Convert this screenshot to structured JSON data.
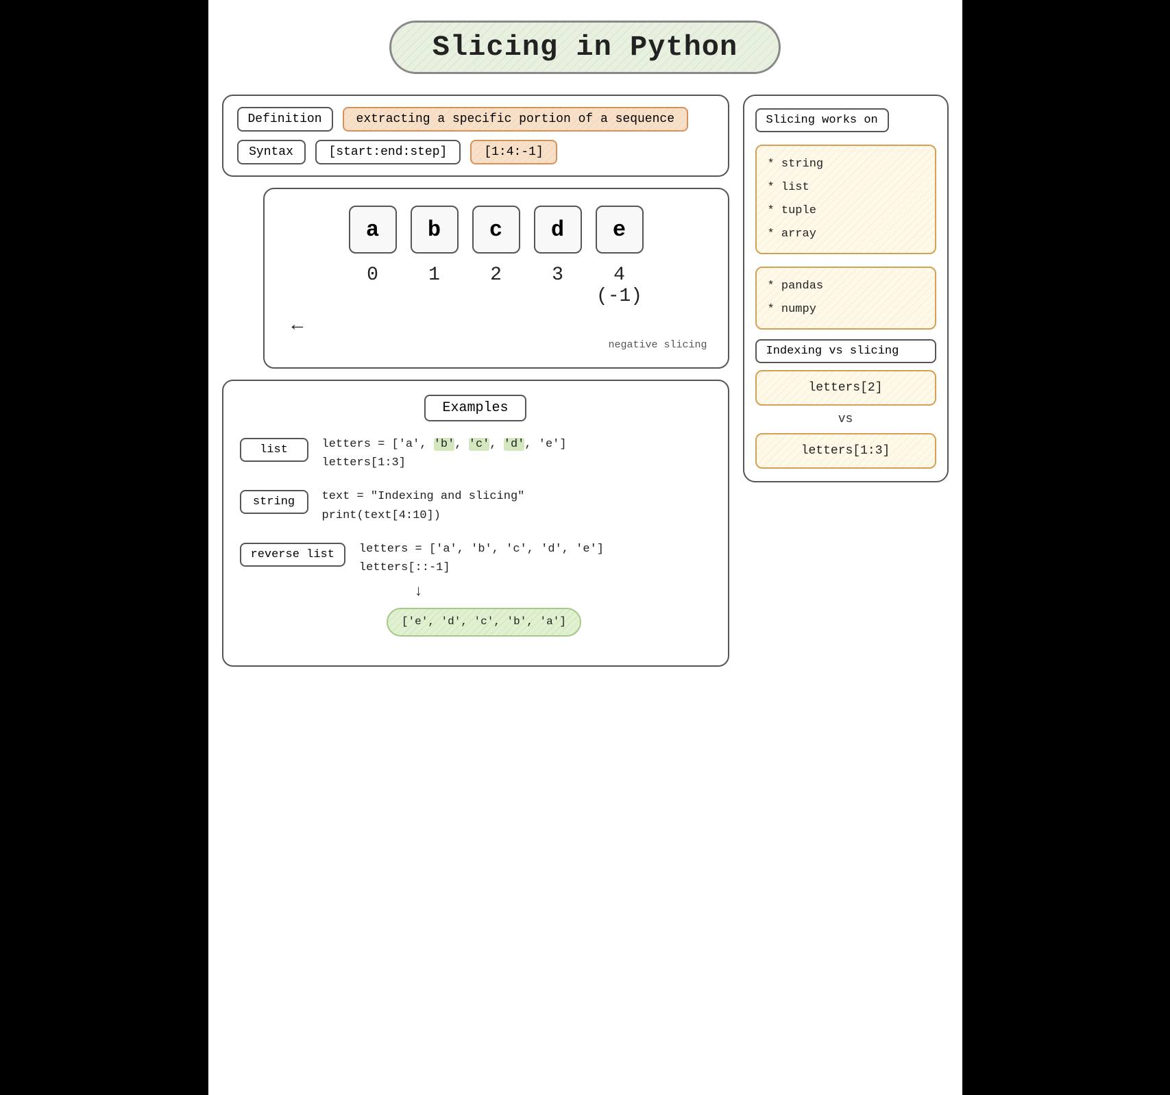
{
  "title": "Slicing in Python",
  "definition": {
    "label": "Definition",
    "value": "extracting a specific portion of a sequence"
  },
  "syntax": {
    "label": "Syntax",
    "format": "[start:end:step]",
    "example": "[1:4:-1]"
  },
  "index_visual": {
    "letters": [
      "a",
      "b",
      "c",
      "d",
      "e"
    ],
    "indices": [
      "0",
      "1",
      "2",
      "3",
      "4 (-1)"
    ],
    "arrow_label": "negative slicing"
  },
  "examples": {
    "title": "Examples",
    "items": [
      {
        "label": "list",
        "line1": "letters = ['a', 'b', 'c', 'd', 'e']",
        "line2": "letters[1:3]",
        "highlights": [
          "b",
          "c",
          "d"
        ]
      },
      {
        "label": "string",
        "line1": "text = \"Indexing and slicing\"",
        "line2": "print(text[4:10])"
      },
      {
        "label": "reverse list",
        "line1": "letters = ['a', 'b', 'c', 'd', 'e']",
        "line2": "letters[::-1]",
        "result": "['e', 'd', 'c', 'b', 'a']"
      }
    ]
  },
  "right_panel": {
    "slicing_works_on": {
      "title": "Slicing works on",
      "group1": [
        "* string",
        "* list",
        "* tuple",
        "* array"
      ],
      "group2": [
        "* pandas",
        "* numpy"
      ]
    },
    "indexing_vs_slicing": {
      "title": "Indexing vs slicing",
      "indexing": "letters[2]",
      "vs": "vs",
      "slicing": "letters[1:3]"
    }
  }
}
